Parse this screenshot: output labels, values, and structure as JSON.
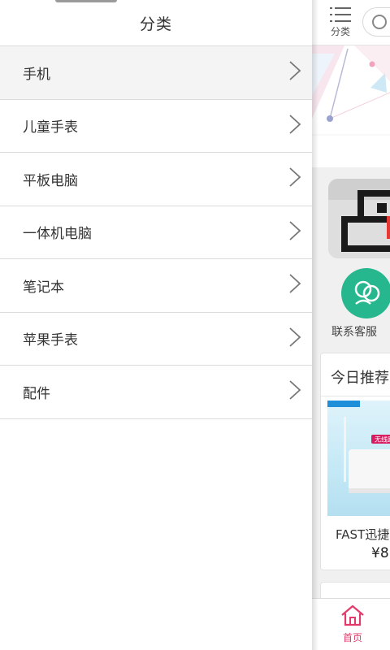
{
  "drawer": {
    "title": "分类",
    "categories": [
      {
        "label": "手机",
        "active": true
      },
      {
        "label": "儿童手表",
        "active": false
      },
      {
        "label": "平板电脑",
        "active": false
      },
      {
        "label": "一体机电脑",
        "active": false
      },
      {
        "label": "笔记本",
        "active": false
      },
      {
        "label": "苹果手表",
        "active": false
      },
      {
        "label": "配件",
        "active": false
      }
    ]
  },
  "main": {
    "topbar": {
      "menu_label": "分类",
      "menu_icon": "list-menu-icon",
      "search_icon": "search-icon"
    },
    "service": {
      "label": "联系客服",
      "icon": "customer-service-icon",
      "color": "#27b78e"
    },
    "recommend": {
      "title": "今日推荐",
      "product_name": "FAST迅捷",
      "product_price": "¥8",
      "tag_text": "无线路"
    },
    "tabbar": {
      "home_label": "首页",
      "home_icon": "home-icon",
      "accent": "#e23a6a"
    }
  }
}
